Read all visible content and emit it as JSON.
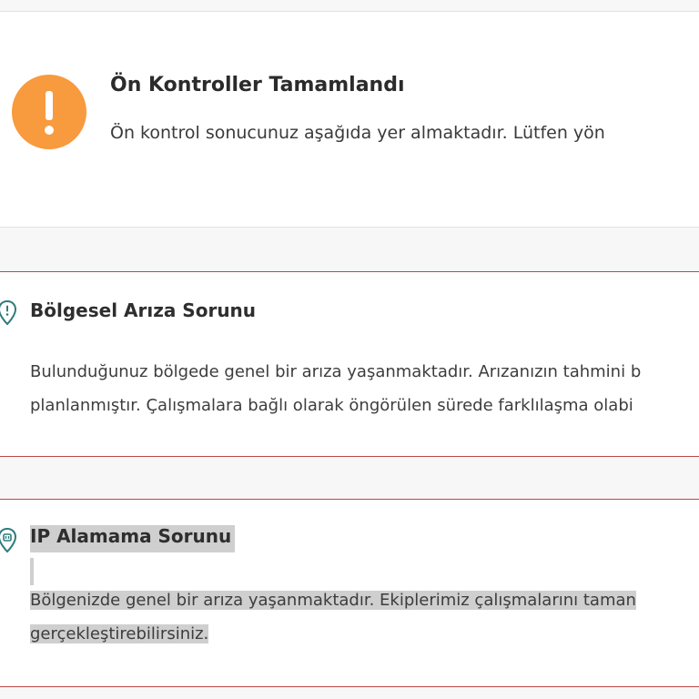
{
  "summary": {
    "title": "Ön Kontroller Tamamlandı",
    "text": "Ön kontrol sonucunuz aşağıda yer almaktadır. Lütfen yön",
    "icon": "exclamation-icon",
    "icon_color": "#f89a3e"
  },
  "issues": [
    {
      "title": "Bölgesel Arıza Sorunu",
      "icon": "location-alert-icon",
      "body_line1": "Bulunduğunuz bölgede genel bir arıza yaşanmaktadır. Arızanızın tahmini b",
      "body_line2": "planlanmıştır. Çalışmalara bağlı olarak öngörülen sürede farklılaşma olabi"
    },
    {
      "title": "IP Alamama Sorunu",
      "icon": "location-router-icon",
      "body_line1": "Bölgenizde genel bir arıza yaşanmaktadır. Ekiplerimiz çalışmalarını taman",
      "body_line2": "gerçekleştirebilirsiniz."
    }
  ],
  "colors": {
    "card_border_red": "#b94a48",
    "teal_icon": "#2f7d7b",
    "selection_gray": "#cfcfcf"
  }
}
